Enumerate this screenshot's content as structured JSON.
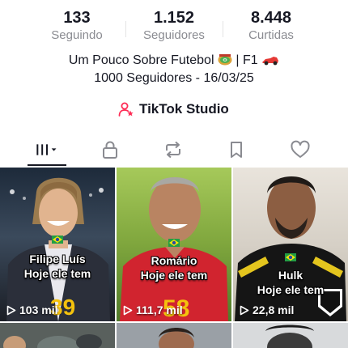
{
  "stats": [
    {
      "value": "133",
      "label": "Seguindo"
    },
    {
      "value": "1.152",
      "label": "Seguidores"
    },
    {
      "value": "8.448",
      "label": "Curtidas"
    }
  ],
  "bio": {
    "line1_a": "Um Pouco Sobre Futebol",
    "line1_b": "| F1",
    "line2": "1000 Seguidores - 16/03/25"
  },
  "studio": {
    "label": "TikTok Studio"
  },
  "tabs": [
    {
      "name": "videos",
      "icon": "grid-icon",
      "active": true
    },
    {
      "name": "private",
      "icon": "lock-icon"
    },
    {
      "name": "reposts",
      "icon": "repost-icon"
    },
    {
      "name": "favorites",
      "icon": "bookmark-icon"
    },
    {
      "name": "liked",
      "icon": "heart-icon"
    }
  ],
  "videos": [
    {
      "caption_line1": "Filipe Luís",
      "caption_line2": "Hoje ele tem",
      "views": "103 mil",
      "jersey_number": "39"
    },
    {
      "caption_line1": "Romário",
      "caption_line2": "Hoje ele tem",
      "views": "111,7 mil",
      "jersey_number": "58"
    },
    {
      "caption_line1": "Hulk",
      "caption_line2": "Hoje ele tem",
      "views": "22,8 mil",
      "jersey_number": ""
    }
  ],
  "colors": {
    "accent": "#fe2c55",
    "text": "#161823",
    "muted": "#8a8b91"
  }
}
